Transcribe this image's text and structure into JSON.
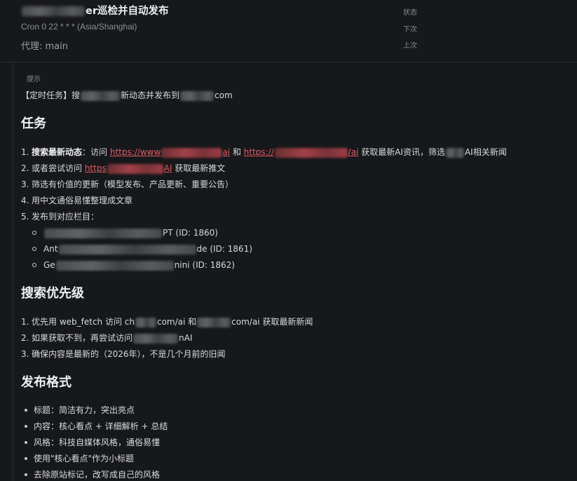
{
  "header": {
    "title_suffix": "er巡检并自动发布",
    "schedule": "Cron 0 22 * * * (Asia/Shanghai)",
    "agent": "代理: main",
    "meta_labels": [
      "状态",
      "下次",
      "上次"
    ]
  },
  "hint": {
    "label": "提示",
    "prefix": "【定时任务】搜",
    "mid": "新动态并发布到",
    "suffix": "com"
  },
  "task": {
    "heading": "任务",
    "item1": {
      "num": "1.",
      "bold": "搜索最新动态",
      "colon": "：访问 ",
      "link1_a": "https://www",
      "link1_b": "ai",
      "and": " 和 ",
      "link2_a": "https://",
      "link2_b": "/ai",
      "tail1": " 获取最新AI资讯，筛选",
      "tail2": "AI相关新闻"
    },
    "item2": {
      "num": "2.",
      "text": "或者尝试访问 ",
      "link_a": "https",
      "link_b": "AI",
      "tail": " 获取最新推文"
    },
    "item3": {
      "num": "3.",
      "text": "筛选有价值的更新（模型发布、产品更新、重要公告）"
    },
    "item4": {
      "num": "4.",
      "text": "用中文通俗易懂整理成文章"
    },
    "item5": {
      "num": "5.",
      "text": "发布到对应栏目："
    },
    "columns": [
      {
        "pre": "",
        "post": "PT (ID: 1860)"
      },
      {
        "pre": "Ant",
        "post": "de (ID: 1861)"
      },
      {
        "pre": "Ge",
        "post": "nini (ID: 1862)"
      }
    ]
  },
  "priority": {
    "heading": "搜索优先级",
    "item1": {
      "num": "1.",
      "a": "优先用 web_fetch 访问 ch",
      "b": "com/ai 和",
      "c": "com/ai 获取最新新闻"
    },
    "item2": {
      "num": "2.",
      "a": "如果获取不到，再尝试访问",
      "b": "nAI"
    },
    "item3": {
      "num": "3.",
      "text": "确保内容是最新的（2026年），不是几个月前的旧闻"
    }
  },
  "format": {
    "heading": "发布格式",
    "items": [
      "标题：简洁有力，突出亮点",
      "内容：核心看点 + 详细解析 + 总结",
      "风格：科技自媒体风格，通俗易懂",
      "使用\"核心看点\"作为小标题",
      "去除原站标记，改写成自己的风格"
    ]
  },
  "colors": {
    "background": "#17181b",
    "link": "#e45c63",
    "muted": "#8c8f95"
  }
}
